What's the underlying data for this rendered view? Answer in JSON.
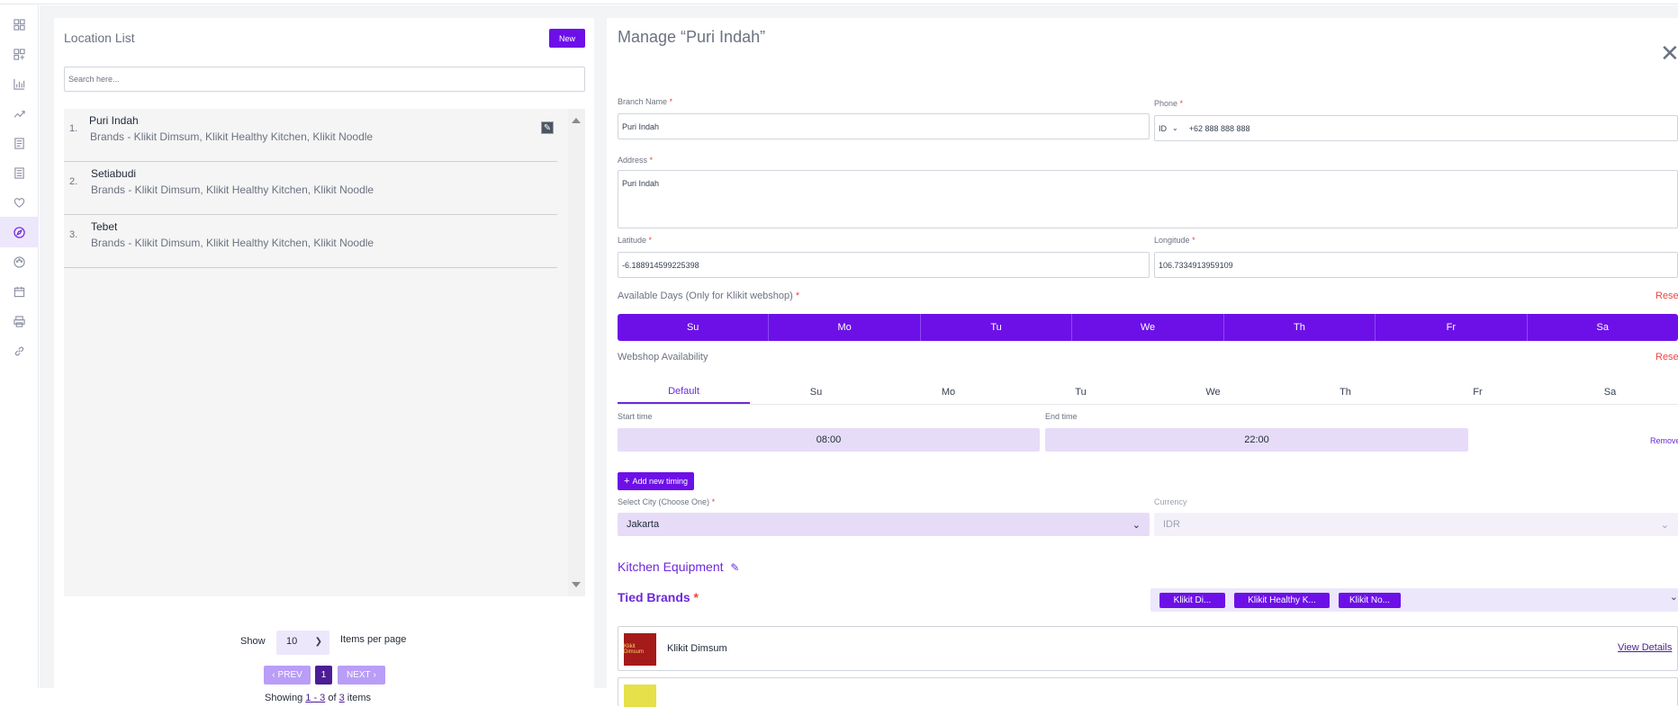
{
  "sidebar": {
    "icons": [
      "dashboard-icon",
      "widgets-icon",
      "bar-chart-icon",
      "trend-icon",
      "orders-icon",
      "reports-icon",
      "heart-icon",
      "compass-icon",
      "palette-icon",
      "calendar-icon",
      "printer-icon",
      "link-icon"
    ],
    "active_index": 7
  },
  "left": {
    "title": "Location List",
    "new_label": "New",
    "search_placeholder": "Search here...",
    "items": [
      {
        "num": "1.",
        "name": "Puri Indah",
        "brands": "Brands - Klikit Dimsum, Klikit Healthy Kitchen, Klikit Noodle"
      },
      {
        "num": "2.",
        "name": "Setiabudi",
        "brands": "Brands - Klikit Dimsum, Klikit Healthy Kitchen, Klikit Noodle"
      },
      {
        "num": "3.",
        "name": "Tebet",
        "brands": "Brands - Klikit Dimsum, Klikit Healthy Kitchen, Klikit Noodle"
      }
    ],
    "show_label": "Show",
    "per_page": "10",
    "per_page_label": "Items per page",
    "prev_label": "PREV",
    "current_page": "1",
    "next_label": "NEXT",
    "showing_prefix": "Showing",
    "showing_range": "1 - 3",
    "showing_of": "of",
    "showing_total": "3",
    "showing_suffix": "items"
  },
  "right": {
    "title": "Manage “Puri Indah”",
    "branch_label": "Branch Name",
    "branch_value": "Puri Indah",
    "phone_label": "Phone",
    "phone_country": "ID",
    "phone_value": "+62 888 888 888",
    "address_label": "Address",
    "address_value": "Puri Indah",
    "latitude_label": "Latitude",
    "latitude_value": "-6.188914599225398",
    "longitude_label": "Longitude",
    "longitude_value": "106.7334913959109",
    "days_label": "Available Days (Only for Klikit webshop)",
    "reset_label": "Reset",
    "days": [
      "Su",
      "Mo",
      "Tu",
      "We",
      "Th",
      "Fr",
      "Sa"
    ],
    "webshop_label": "Webshop Availability",
    "tabs": [
      "Default",
      "Su",
      "Mo",
      "Tu",
      "We",
      "Th",
      "Fr",
      "Sa"
    ],
    "start_label": "Start time",
    "start_value": "08:00",
    "end_label": "End time",
    "end_value": "22:00",
    "remove_label": "Remove",
    "add_timing_label": "Add new timing",
    "city_label": "Select City (Choose One)",
    "city_value": "Jakarta",
    "currency_label": "Currency",
    "currency_value": "IDR",
    "kitchen_label": "Kitchen Equipment",
    "tied_label": "Tied Brands",
    "chips": [
      "Klikit Di...",
      "Klikit Healthy K...",
      "Klikit No..."
    ],
    "brand_row_name": "Klikit Dimsum",
    "brand_logo_text": "Klikit Dimsum",
    "view_details": "View Details",
    "required_mark": "*"
  }
}
